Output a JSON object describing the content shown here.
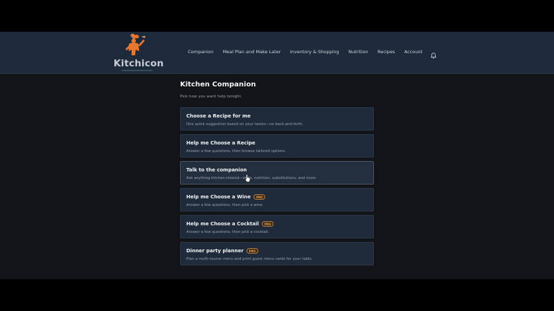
{
  "brand": {
    "name": "Kitchicon",
    "logo_icon": "chef-figure-logo"
  },
  "nav": {
    "items": [
      "Companion",
      "Meal Plan and Make Later",
      "Inventory & Shopping",
      "Nutrition",
      "Recipes",
      "Account"
    ],
    "notification_icon": "bell-icon"
  },
  "page": {
    "title": "Kitchen Companion",
    "subtitle": "Pick how you want help tonight."
  },
  "options": [
    {
      "title": "Choose a Recipe for me",
      "description": "One quick suggestion based on your tastes—no back-and-forth.",
      "badge": ""
    },
    {
      "title": "Help me Choose a Recipe",
      "description": "Answer a few questions, then browse tailored options.",
      "badge": ""
    },
    {
      "title": "Talk to the companion",
      "description": "Ask anything kitchen-related—skills, nutrition, substitutions, and more.",
      "badge": ""
    },
    {
      "title": "Help me Choose a Wine",
      "description": "Answer a few questions, then pick a wine.",
      "badge": "PRO"
    },
    {
      "title": "Help me Choose a Cocktail",
      "description": "Answer a few questions, then pick a cocktail.",
      "badge": "PRO"
    },
    {
      "title": "Dinner party planner",
      "description": "Plan a multi-course menu and print guest menu cards for your table.",
      "badge": "PRO"
    }
  ],
  "colors": {
    "header_bg": "#1c2a3b",
    "page_bg": "#121417",
    "card_bg": "#1f2b3b",
    "pro_accent": "#e0a15a",
    "logo_orange": "#e8772e"
  }
}
